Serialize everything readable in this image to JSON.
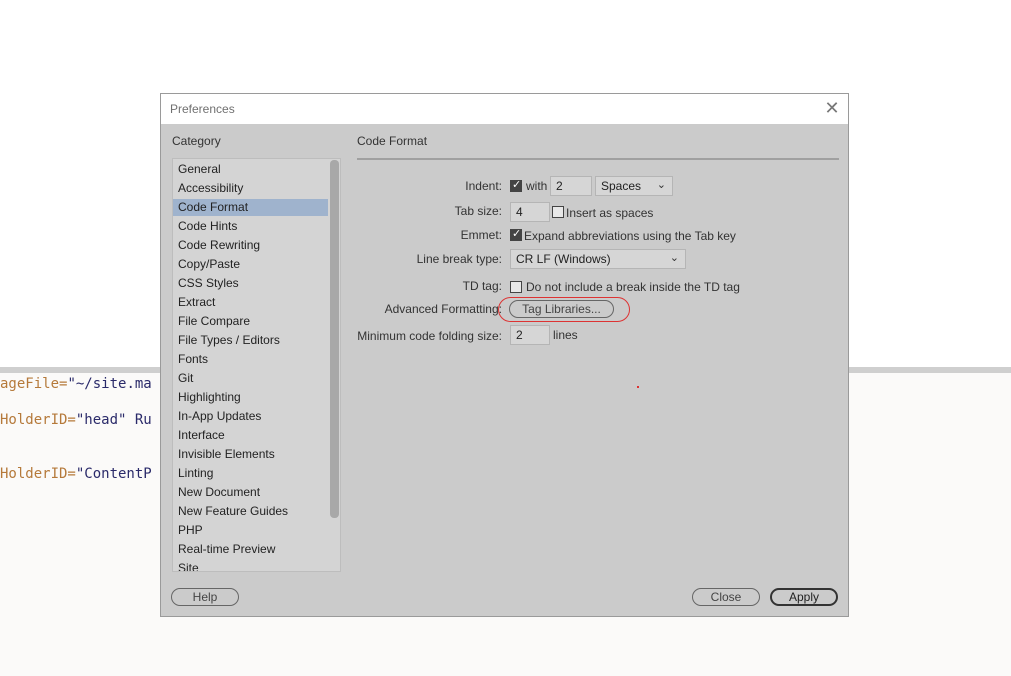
{
  "background": {
    "code_lines": [
      {
        "attr": "ageFile=",
        "val": "\"~/site.ma"
      },
      {
        "attr": "HolderID=",
        "val": "\"head\" Ru"
      },
      {
        "attr": "HolderID=",
        "val": "\"ContentP"
      }
    ]
  },
  "dialog": {
    "title": "Preferences",
    "category_label": "Category",
    "categories": [
      "General",
      "Accessibility",
      "Code Format",
      "Code Hints",
      "Code Rewriting",
      "Copy/Paste",
      "CSS Styles",
      "Extract",
      "File Compare",
      "File Types / Editors",
      "Fonts",
      "Git",
      "Highlighting",
      "In-App Updates",
      "Interface",
      "Invisible Elements",
      "Linting",
      "New Document",
      "New Feature Guides",
      "PHP",
      "Real-time Preview",
      "Site"
    ],
    "selected_category": "Code Format",
    "section_title": "Code Format",
    "indent": {
      "label": "Indent:",
      "with_label": "with",
      "value": "2",
      "unit": "Spaces"
    },
    "tab_size": {
      "label": "Tab size:",
      "value": "4",
      "insert_label": "Insert as spaces"
    },
    "emmet": {
      "label": "Emmet:",
      "option_label": "Expand abbreviations using the Tab key"
    },
    "line_break": {
      "label": "Line break type:",
      "value": "CR LF (Windows)"
    },
    "td_tag": {
      "label": "TD tag:",
      "option_label": "Do not include a break inside the TD tag"
    },
    "advanced": {
      "label": "Advanced Formatting:",
      "button_label": "Tag Libraries..."
    },
    "folding": {
      "label": "Minimum code folding size:",
      "value": "2",
      "unit": "lines"
    },
    "buttons": {
      "help": "Help",
      "close": "Close",
      "apply": "Apply"
    }
  }
}
